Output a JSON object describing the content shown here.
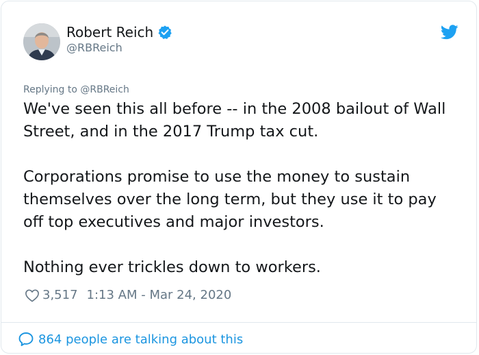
{
  "tweet": {
    "author_name": "Robert Reich",
    "author_handle": "@RBReich",
    "avatar_icon": "user-avatar",
    "verified_icon": "verified-badge-icon",
    "platform_icon": "twitter-bird-icon",
    "replying_to": "Replying to @RBReich",
    "paragraphs": [
      "We've seen this all before -- in the 2008 bailout of Wall Street, and in the 2017 Trump tax cut.",
      "Corporations promise to use the money to sustain themselves over the long term, but they use it to pay off top executives and major investors.",
      "Nothing ever trickles down to workers."
    ],
    "likes": "3,517",
    "timestamp": "1:13 AM - Mar 24, 2020",
    "talking_about": "864 people are talking about this"
  },
  "colors": {
    "accent": "#1da1f2",
    "link": "#1b95e0",
    "muted": "#657786",
    "text": "#14171a",
    "border": "#e1e8ed"
  }
}
